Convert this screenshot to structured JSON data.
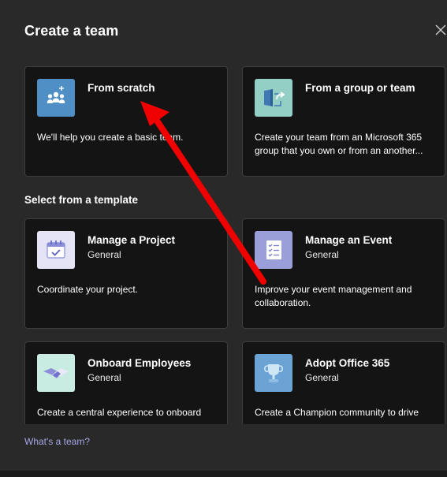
{
  "dialog": {
    "title": "Create a team",
    "close_label": "Close"
  },
  "top_cards": [
    {
      "title": "From scratch",
      "description": "We'll help you create a basic team.",
      "icon": "people-group-icon"
    },
    {
      "title": "From a group or team",
      "description": "Create your team from an Microsoft 365 group that you own or from an another...",
      "icon": "export-arrow-icon"
    }
  ],
  "templates": {
    "section_label": "Select from a template",
    "items": [
      {
        "title": "Manage a Project",
        "category": "General",
        "description": "Coordinate your project.",
        "icon": "calendar-check-icon"
      },
      {
        "title": "Manage an Event",
        "category": "General",
        "description": "Improve your event management and collaboration.",
        "icon": "clipboard-checklist-icon"
      },
      {
        "title": "Onboard Employees",
        "category": "General",
        "description": "Create a central experience to onboard",
        "icon": "handshake-icon"
      },
      {
        "title": "Adopt Office 365",
        "category": "General",
        "description": "Create a Champion community to drive",
        "icon": "trophy-icon"
      }
    ]
  },
  "footer": {
    "link_text": "What's a team?"
  },
  "colors": {
    "dialog_bg": "#292929",
    "card_bg": "#141414",
    "link": "#a4a7e6",
    "annotation_arrow": "#ff0000"
  }
}
